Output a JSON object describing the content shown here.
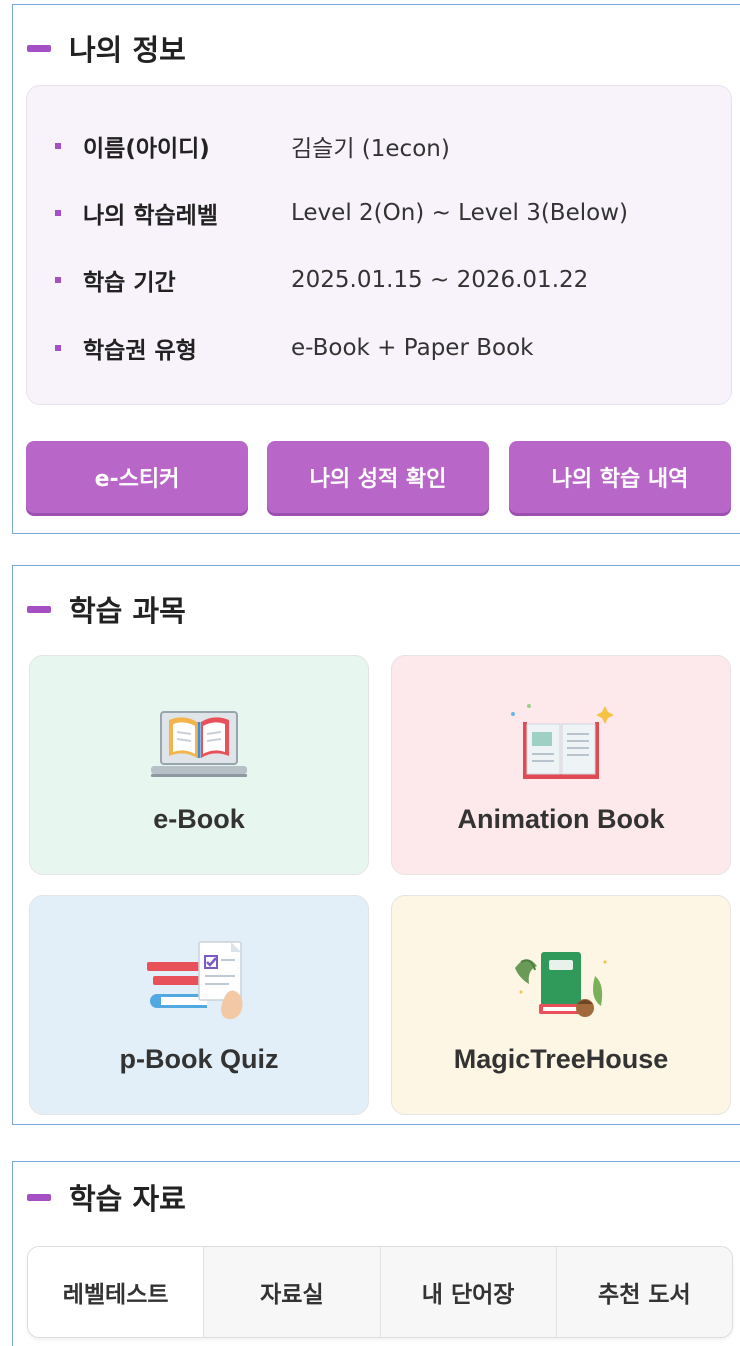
{
  "my_info": {
    "title": "나의 정보",
    "rows": [
      {
        "label": "이름(아이디)",
        "value": "김슬기 (1econ)"
      },
      {
        "label": "나의 학습레벨",
        "value": "Level 2(On) ~ Level 3(Below)"
      },
      {
        "label": "학습 기간",
        "value": "2025.01.15 ~ 2026.01.22"
      },
      {
        "label": "학습권 유형",
        "value": "e-Book + Paper Book"
      }
    ],
    "buttons": [
      "e-스티커",
      "나의 성적 확인",
      "나의 학습 내역"
    ]
  },
  "subjects": {
    "title": "학습 과목",
    "cards": [
      {
        "label": "e-Book",
        "icon": "laptop-book-icon",
        "bg": "#e8f6f0"
      },
      {
        "label": "Animation Book",
        "icon": "open-book-icon",
        "bg": "#fde9ec"
      },
      {
        "label": "p-Book Quiz",
        "icon": "quiz-books-icon",
        "bg": "#e2eff9"
      },
      {
        "label": "MagicTreeHouse",
        "icon": "green-book-icon",
        "bg": "#fdf6e4"
      }
    ]
  },
  "materials": {
    "title": "학습 자료",
    "tabs": [
      "레벨테스트",
      "자료실",
      "내 단어장",
      "추천 도서"
    ]
  },
  "colors": {
    "accent": "#a450c4",
    "button": "#b867c8",
    "panel_border": "#7aa7dd"
  }
}
